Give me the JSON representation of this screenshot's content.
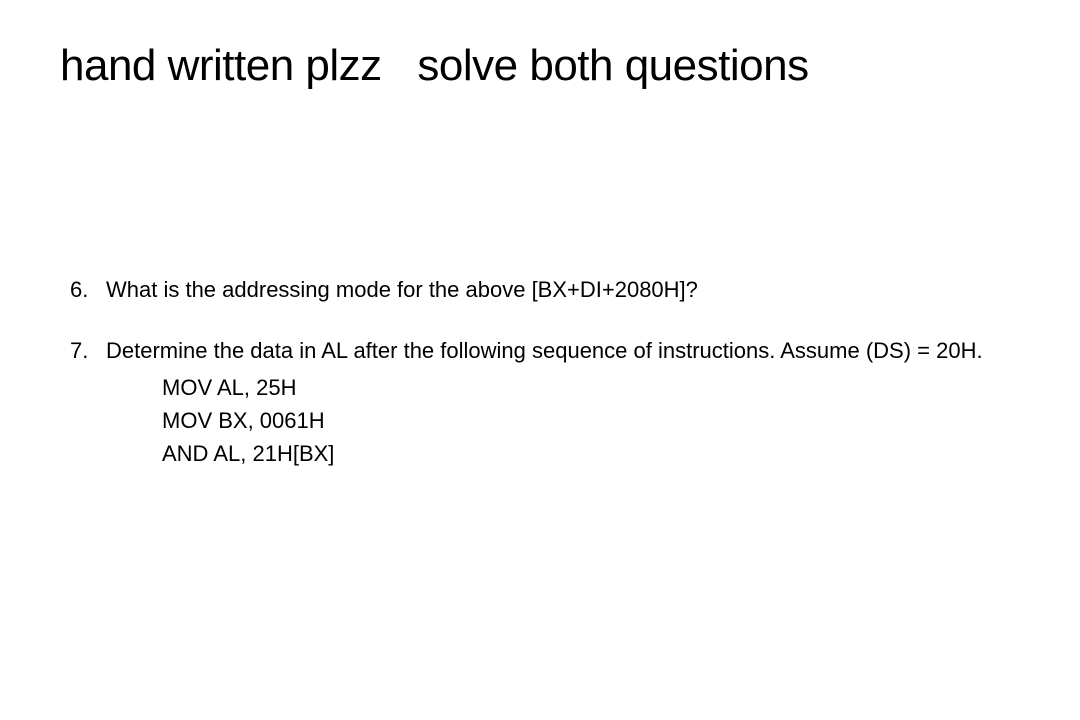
{
  "header": {
    "part1": "hand written plzz",
    "part2": "solve both questions"
  },
  "questions": [
    {
      "number": "6.",
      "text": "What is the addressing mode for the above [BX+DI+2080H]?"
    },
    {
      "number": "7.",
      "text": "Determine the data in AL after the following sequence of instructions. Assume (DS) = 20H.",
      "code": [
        "MOV AL, 25H",
        "MOV BX, 0061H",
        "AND AL, 21H[BX]"
      ]
    }
  ]
}
